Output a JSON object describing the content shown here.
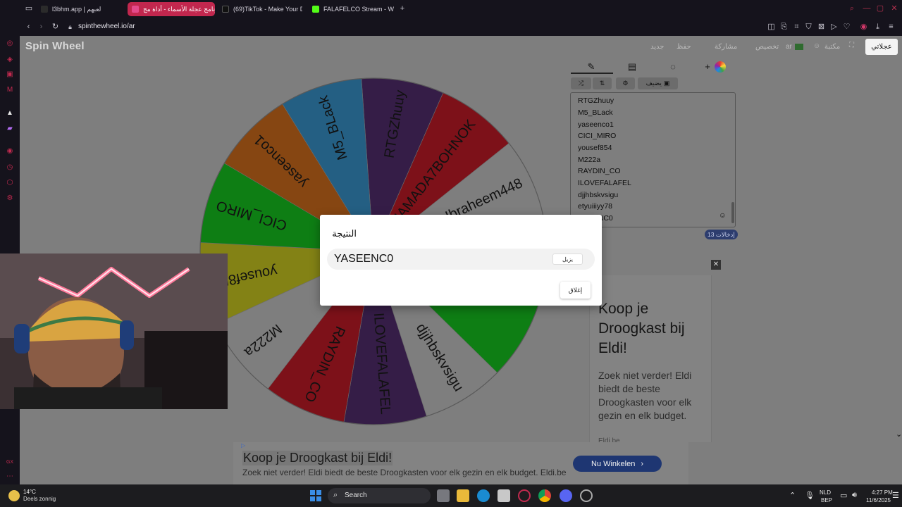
{
  "browser": {
    "tabs": [
      {
        "label": "l3bhm.app | لعبهم",
        "active": false,
        "icon_color": "#2b2b2b"
      },
      {
        "label": "برنامج عجلة الأسماء - أداة مج...",
        "active": true,
        "icon_color": "#e44a8b"
      },
      {
        "label": "(69)TikTok - Make Your D...",
        "active": false,
        "icon_color": "#111111"
      },
      {
        "label": "FALAFELCO Stream - Wat...",
        "active": false,
        "icon_color": "#53fc18"
      }
    ],
    "new_tab": "+",
    "url": "spinthewheel.io/ar"
  },
  "site": {
    "logo": "Spin Wheel",
    "menu": {
      "new": "جديد",
      "save": "حفظ",
      "share": "مشاركة",
      "customize": "تخصيص",
      "lang": "ar",
      "gallery": "مكتبة",
      "my_wheels": "عجلاتي"
    }
  },
  "wheel": {
    "segments": [
      {
        "label": "RTGZhuuy",
        "color": "#351d47"
      },
      {
        "label": "HAMADA7BOHNOK",
        "color": "#7d1119"
      },
      {
        "label": "Ibraheem448",
        "color": "#7e7e7e"
      },
      {
        "label": "YASEENC0",
        "color": "#838215"
      },
      {
        "label": "",
        "color": "#0e7e14"
      },
      {
        "label": "djjhbskvsigu",
        "color": "#7e7e7e"
      },
      {
        "label": "ILOVEFALAFEL",
        "color": "#351d47"
      },
      {
        "label": "RAYDIN_CO",
        "color": "#7d1119"
      },
      {
        "label": "M222a",
        "color": "#7e7e7e"
      },
      {
        "label": "yousef854",
        "color": "#838215"
      },
      {
        "label": "CICI_MIRO",
        "color": "#0e7e14"
      },
      {
        "label": "yaseenco1",
        "color": "#864612"
      },
      {
        "label": "M5_BLack",
        "color": "#245f83"
      }
    ]
  },
  "entries_panel": {
    "add_image": "يضيف",
    "items": [
      "RTGZhuuy",
      "M5_BLack",
      "yaseenco1",
      "CICI_MIRO",
      "yousef854",
      "M222a",
      "RAYDIN_CO",
      "ILOVEFALAFEL",
      "djjhbskvsigu",
      "etyuiiiyy78",
      "...NC0"
    ],
    "count": "إدخالات 13"
  },
  "modal": {
    "title": "النتيجة",
    "result": "YASEENC0",
    "remove": "يزيل",
    "close": "إغلاق"
  },
  "ad_side": {
    "close": "✕",
    "headline": "Koop je Droogkast bij Eldi!",
    "body": "Zoek niet verder! Eldi biedt de beste Droogkasten voor elk gezin en elk budget.",
    "source": "Eldi.be"
  },
  "banner": {
    "headline": "Koop je Droogkast bij Eldi!",
    "body": "Zoek niet verder! Eldi biedt de beste Droogkasten voor elk gezin en elk budget. Eldi.be",
    "cta": "Nu Winkelen"
  },
  "taskbar": {
    "temp": "14°C",
    "weather": "Deels zonnig",
    "search": "Search",
    "lang1": "NLD",
    "lang2": "BEP",
    "time": "4:27 PM",
    "date": "11/6/2025"
  }
}
